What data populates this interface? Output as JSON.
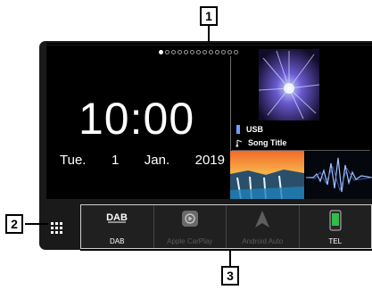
{
  "callouts": {
    "one": "1",
    "two": "2",
    "three": "3"
  },
  "clock": {
    "time": "10:00",
    "weekday": "Tue.",
    "day": "1",
    "month": "Jan.",
    "year": "2019"
  },
  "media": {
    "source": "USB",
    "title": "Song Title"
  },
  "page_indicator": {
    "total": 13,
    "active": 0
  },
  "dock": {
    "items": [
      {
        "label": "DAB",
        "enabled": true
      },
      {
        "label": "Apple CarPlay",
        "enabled": false
      },
      {
        "label": "Android Auto",
        "enabled": false
      },
      {
        "label": "TEL",
        "enabled": true
      }
    ]
  }
}
